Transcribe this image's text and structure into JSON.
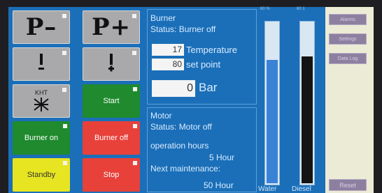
{
  "tiles": {
    "p_minus": "P–",
    "p_plus": "P+",
    "kht_label": "KHT",
    "start": "Start",
    "burner_on": "Burner on",
    "burner_off": "Burner off",
    "standby": "Standby",
    "stop": "Stop"
  },
  "burner": {
    "title": "Burner",
    "status": "Status: Burner off",
    "temperature_value": "17",
    "temperature_label": "Temperature",
    "setpoint_value": "80",
    "setpoint_label": "set point",
    "pressure_value": "0",
    "pressure_unit": "Bar"
  },
  "motor": {
    "title": "Motor",
    "status": "Status: Motor off",
    "hours_label": "operation hours",
    "hours_value": "5 Hour",
    "maintenance_label": "Next maintenance:",
    "maintenance_value": "50 Hour"
  },
  "levels": {
    "water_label": "Water",
    "diesel_label": "Diesel",
    "water_scale": "60 %",
    "diesel_scale": "60 1",
    "water_fraction": 0.77,
    "diesel_fraction": 0.79,
    "colors": {
      "water": "#3a82d6",
      "diesel": "#141414"
    }
  },
  "menu": {
    "alarms": "Alarms",
    "settings": "Settings",
    "data_log": "Data Log",
    "reset": "Reset"
  },
  "colors": {
    "panel_bg": "#1b6fb8",
    "green": "#1f8a2e",
    "red": "#e8413a",
    "yellow": "#e7e521",
    "gray": "#a9a9ab"
  }
}
